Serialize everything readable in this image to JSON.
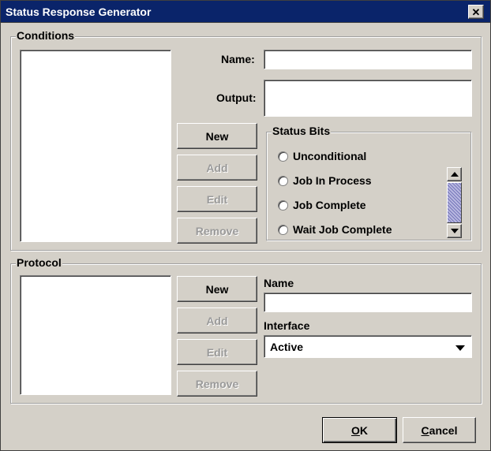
{
  "window": {
    "title": "Status Response Generator",
    "close_glyph": "✕"
  },
  "conditions": {
    "group_title": "Conditions",
    "name_label": "Name:",
    "name_value": "",
    "output_label": "Output:",
    "output_value": "",
    "buttons": {
      "new": "New",
      "add": "Add",
      "edit": "Edit",
      "remove": "Remove"
    },
    "status_bits": {
      "title": "Status Bits",
      "items": [
        "Unconditional",
        "Job In Process",
        "Job Complete",
        "Wait Job Complete"
      ]
    }
  },
  "protocol": {
    "group_title": "Protocol",
    "buttons": {
      "new": "New",
      "add": "Add",
      "edit": "Edit",
      "remove": "Remove"
    },
    "name_label": "Name",
    "name_value": "",
    "interface_label": "Interface",
    "interface_value": "Active"
  },
  "footer": {
    "ok_mnemonic": "O",
    "ok_rest": "K",
    "cancel_mnemonic": "C",
    "cancel_rest": "ancel"
  },
  "colors": {
    "titlebar": "#0a246a",
    "panel": "#d4d0c8",
    "scroll_thumb": "#9999cc"
  }
}
